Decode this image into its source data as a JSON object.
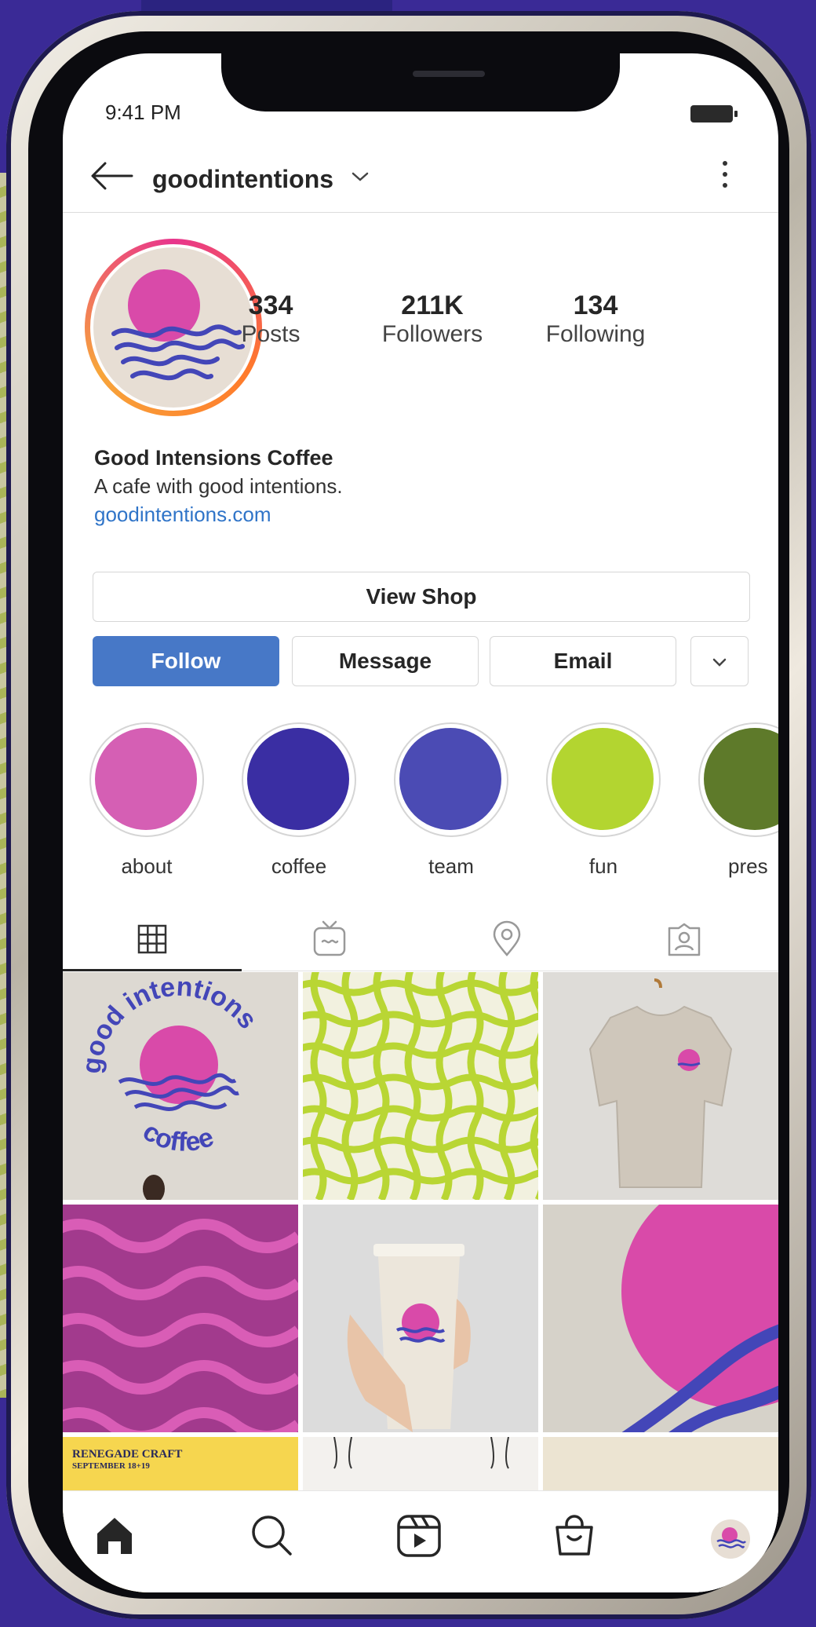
{
  "status_bar": {
    "time": "9:41 PM"
  },
  "header": {
    "username": "goodintentions"
  },
  "profile": {
    "stats": [
      {
        "value": "334",
        "label": "Posts"
      },
      {
        "value": "211K",
        "label": "Followers"
      },
      {
        "value": "134",
        "label": "Following"
      }
    ],
    "name": "Good Intensions Coffee",
    "bio": "A cafe with good intentions.",
    "link": "goodintentions.com"
  },
  "actions": {
    "view_shop": "View Shop",
    "follow": "Follow",
    "message": "Message",
    "email": "Email"
  },
  "highlights": [
    {
      "label": "about",
      "color": "#d55fb4"
    },
    {
      "label": "coffee",
      "color": "#3a2ea3"
    },
    {
      "label": "team",
      "color": "#4b4bb4"
    },
    {
      "label": "fun",
      "color": "#b3d530"
    },
    {
      "label": "pres",
      "color": "#5e7a2a"
    }
  ],
  "tabs": [
    "grid-icon",
    "igtv-icon",
    "location-icon",
    "tagged-icon"
  ],
  "posts": {
    "logo_text_top": "good intentions",
    "logo_text_bottom": "coffee",
    "event_title": "RENEGADE CRAFT",
    "event_date": "SEPTEMBER 18+19"
  },
  "colors": {
    "brand_pink": "#d94aa9",
    "brand_blue": "#4346b8",
    "lime": "#b9d634",
    "follow_blue": "#4778c7",
    "link_blue": "#2f74c8"
  },
  "nav": [
    "home-icon",
    "search-icon",
    "reels-icon",
    "shop-icon",
    "profile-avatar"
  ]
}
